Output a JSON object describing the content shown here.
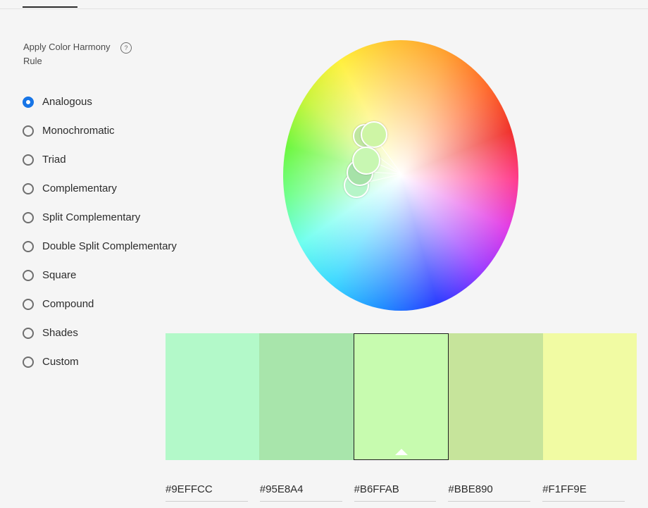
{
  "harmony": {
    "heading": "Apply Color Harmony Rule",
    "help_icon": "help-icon",
    "selected": "Analogous",
    "rules": [
      {
        "label": "Analogous",
        "selected": true
      },
      {
        "label": "Monochromatic",
        "selected": false
      },
      {
        "label": "Triad",
        "selected": false
      },
      {
        "label": "Complementary",
        "selected": false
      },
      {
        "label": "Split Complementary",
        "selected": false
      },
      {
        "label": "Double Split Complementary",
        "selected": false
      },
      {
        "label": "Square",
        "selected": false
      },
      {
        "label": "Compound",
        "selected": false
      },
      {
        "label": "Shades",
        "selected": false
      },
      {
        "label": "Custom",
        "selected": false
      }
    ]
  },
  "swatches": [
    {
      "hex": "#9EFFCC",
      "color": "#b3f9c9",
      "selected": false
    },
    {
      "hex": "#95E8A4",
      "color": "#a8e5ab",
      "selected": false
    },
    {
      "hex": "#B6FFAB",
      "color": "#c7fbaf",
      "selected": true
    },
    {
      "hex": "#BBE890",
      "color": "#c6e49b",
      "selected": false
    },
    {
      "hex": "#F1FF9E",
      "color": "#f1fba3",
      "selected": false
    }
  ],
  "colors": {
    "accent": "#1473e6"
  }
}
